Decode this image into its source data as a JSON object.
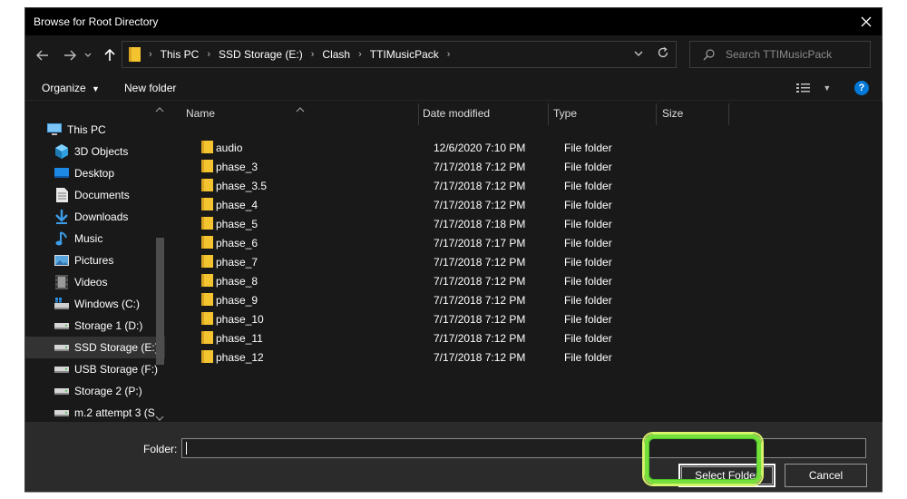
{
  "window": {
    "title": "Browse for Root Directory"
  },
  "address": {
    "crumbs": [
      "This PC",
      "SSD Storage (E:)",
      "Clash",
      "TTIMusicPack"
    ]
  },
  "search": {
    "placeholder": "Search TTIMusicPack"
  },
  "toolbar": {
    "organize_label": "Organize",
    "new_folder_label": "New folder"
  },
  "nav": {
    "items": [
      {
        "label": "This PC",
        "icon": "pc-icon"
      },
      {
        "label": "3D Objects",
        "icon": "cube-icon"
      },
      {
        "label": "Desktop",
        "icon": "desktop-icon"
      },
      {
        "label": "Documents",
        "icon": "document-icon"
      },
      {
        "label": "Downloads",
        "icon": "download-icon"
      },
      {
        "label": "Music",
        "icon": "music-icon"
      },
      {
        "label": "Pictures",
        "icon": "pictures-icon"
      },
      {
        "label": "Videos",
        "icon": "videos-icon"
      },
      {
        "label": "Windows (C:)",
        "icon": "windows-drive-icon"
      },
      {
        "label": "Storage 1 (D:)",
        "icon": "drive-icon"
      },
      {
        "label": "SSD Storage (E:)",
        "icon": "drive-icon",
        "selected": true
      },
      {
        "label": "USB Storage (F:)",
        "icon": "drive-icon"
      },
      {
        "label": "Storage 2 (P:)",
        "icon": "drive-icon"
      },
      {
        "label": "m.2 attempt 3 (S",
        "icon": "drive-icon"
      }
    ]
  },
  "columns": {
    "name": "Name",
    "date": "Date modified",
    "type": "Type",
    "size": "Size"
  },
  "files": [
    {
      "name": "audio",
      "date": "12/6/2020 7:10 PM",
      "type": "File folder"
    },
    {
      "name": "phase_3",
      "date": "7/17/2018 7:12 PM",
      "type": "File folder"
    },
    {
      "name": "phase_3.5",
      "date": "7/17/2018 7:12 PM",
      "type": "File folder"
    },
    {
      "name": "phase_4",
      "date": "7/17/2018 7:12 PM",
      "type": "File folder"
    },
    {
      "name": "phase_5",
      "date": "7/17/2018 7:18 PM",
      "type": "File folder"
    },
    {
      "name": "phase_6",
      "date": "7/17/2018 7:17 PM",
      "type": "File folder"
    },
    {
      "name": "phase_7",
      "date": "7/17/2018 7:12 PM",
      "type": "File folder"
    },
    {
      "name": "phase_8",
      "date": "7/17/2018 7:12 PM",
      "type": "File folder"
    },
    {
      "name": "phase_9",
      "date": "7/17/2018 7:12 PM",
      "type": "File folder"
    },
    {
      "name": "phase_10",
      "date": "7/17/2018 7:12 PM",
      "type": "File folder"
    },
    {
      "name": "phase_11",
      "date": "7/17/2018 7:12 PM",
      "type": "File folder"
    },
    {
      "name": "phase_12",
      "date": "7/17/2018 7:12 PM",
      "type": "File folder"
    }
  ],
  "footer": {
    "folder_label": "Folder:",
    "folder_value": "",
    "select_label": "Select Folder",
    "cancel_label": "Cancel"
  },
  "colors": {
    "folder": "#f4c430",
    "accent": "#0078d7",
    "highlight": "#76e03a"
  }
}
